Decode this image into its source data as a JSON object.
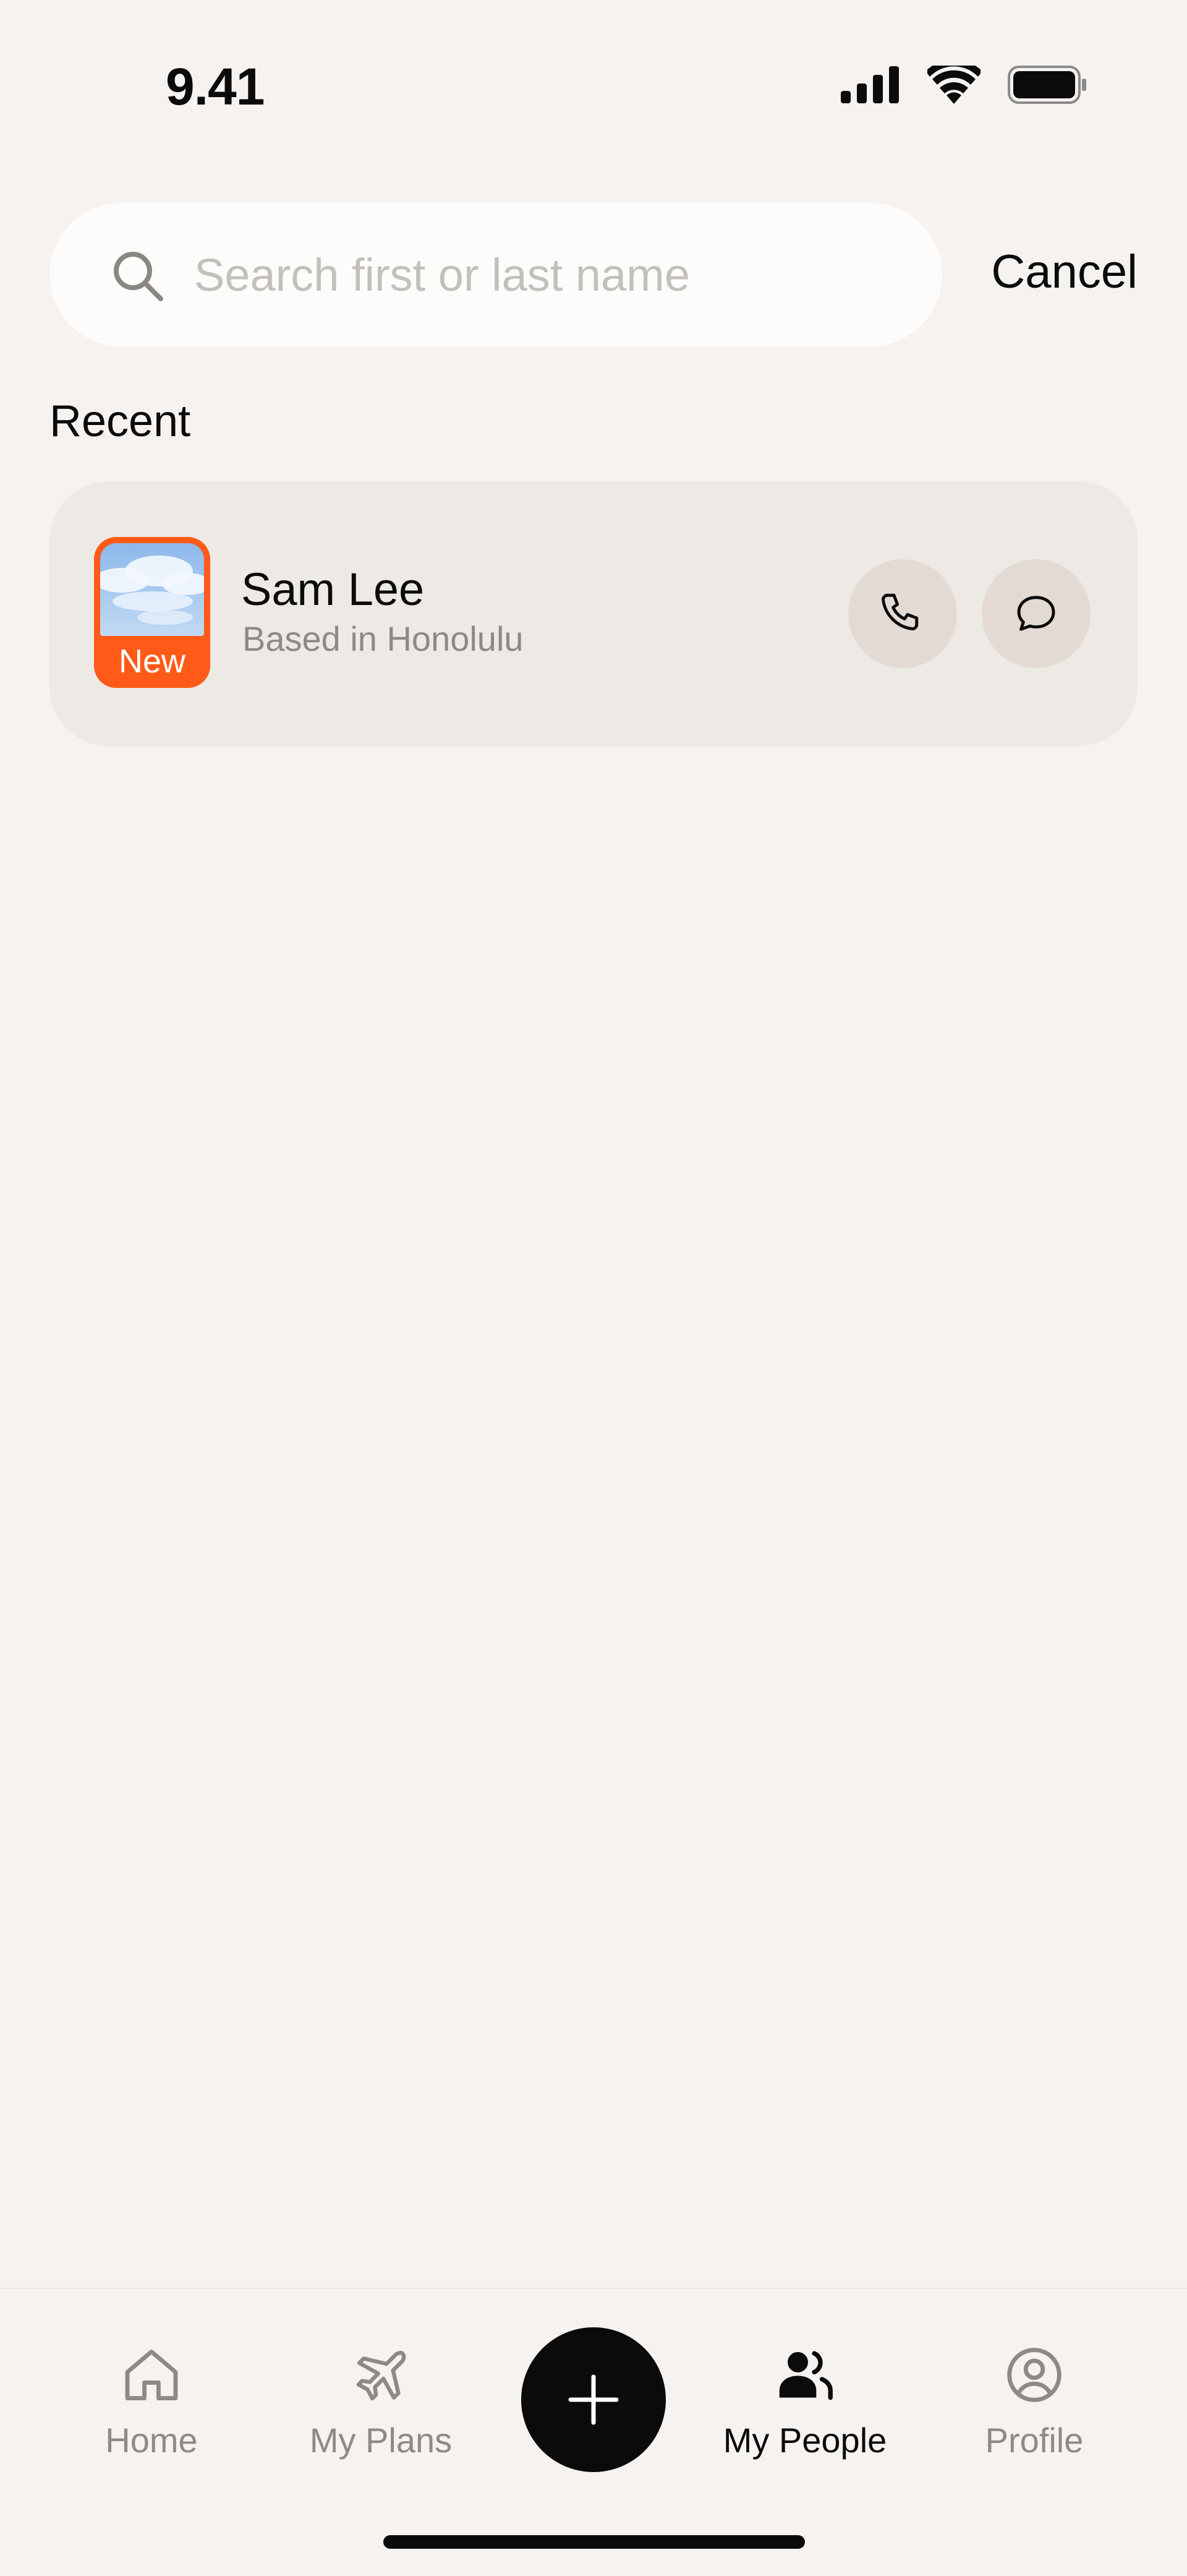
{
  "status_bar": {
    "time": "9.41",
    "icons": [
      "signal-icon",
      "wifi-icon",
      "battery-icon"
    ]
  },
  "search": {
    "placeholder": "Search first or last name",
    "value": "",
    "cancel_label": "Cancel"
  },
  "recent": {
    "title": "Recent",
    "contacts": [
      {
        "name": "Sam Lee",
        "subtitle": "Based in Honolulu",
        "badge": "New",
        "actions": [
          "phone-icon",
          "chat-bubble-icon"
        ]
      }
    ]
  },
  "tab_bar": {
    "tabs": [
      {
        "label": "Home",
        "icon": "home-icon",
        "active": false
      },
      {
        "label": "My Plans",
        "icon": "airplane-icon",
        "active": false
      },
      {
        "label": "My People",
        "icon": "people-icon",
        "active": true
      },
      {
        "label": "Profile",
        "icon": "profile-icon",
        "active": false
      }
    ],
    "add_icon": "plus-icon"
  },
  "colors": {
    "background": "#F5F2EF",
    "accent": "#FF5A17",
    "card": "#EDE9E5",
    "action_button": "#E3DBD3",
    "text_primary": "#0B0B0B",
    "text_secondary": "#8D8A86"
  }
}
